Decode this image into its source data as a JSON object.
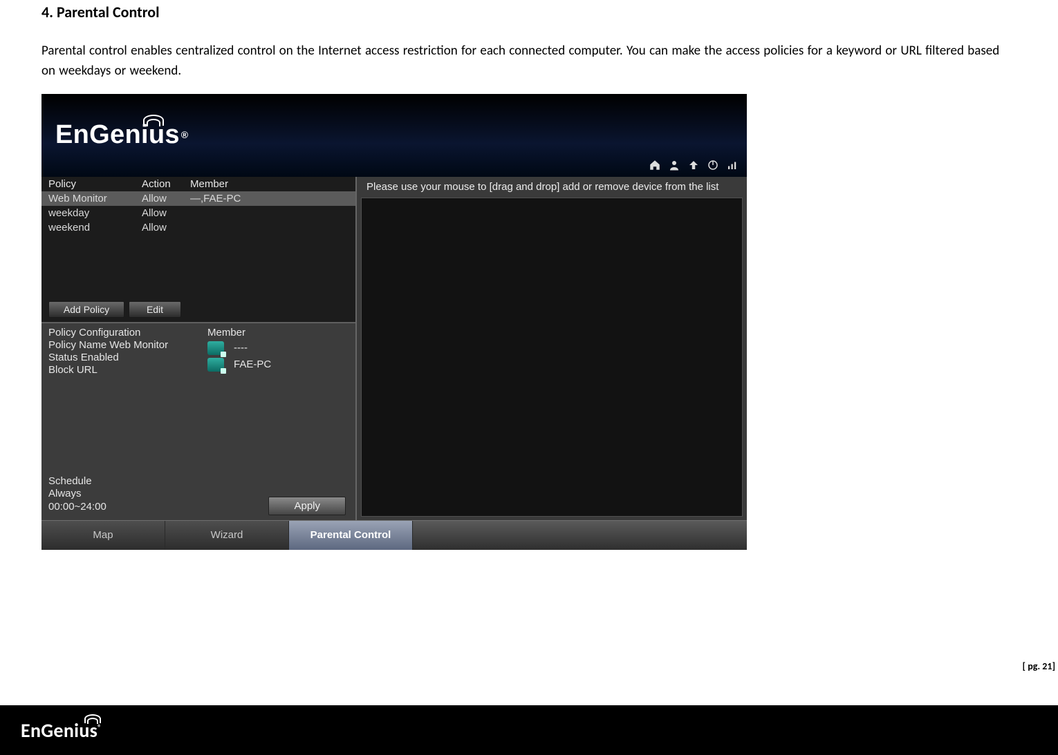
{
  "doc": {
    "heading": "4.  Parental Control",
    "paragraph": "Parental control enables centralized control on the Internet access restriction for each connected computer. You can make the access policies for a keyword or URL filtered based on weekdays or weekend.",
    "page_number": "[ pg. 21]"
  },
  "brand": {
    "name": "EnGenius",
    "registered": "®"
  },
  "toolbar_icons": {
    "home": "home-icon",
    "user": "user-icon",
    "wifi": "network-icon",
    "power": "power-icon",
    "graph": "status-icon"
  },
  "policy_table": {
    "headers": {
      "c1": "Policy",
      "c2": "Action",
      "c3": "Member"
    },
    "rows": [
      {
        "c1": "Web Monitor",
        "c2": "Allow",
        "c3": "—,FAE-PC",
        "selected": true
      },
      {
        "c1": "weekday",
        "c2": "Allow",
        "c3": ""
      },
      {
        "c1": "weekend",
        "c2": "Allow",
        "c3": ""
      }
    ],
    "add_btn": "Add Policy",
    "edit_btn": "Edit"
  },
  "policy_config": {
    "title": "Policy Configuration",
    "name_line": "Policy Name Web Monitor",
    "status_line": "Status Enabled",
    "block_line": "Block URL",
    "member_header": "Member",
    "members": [
      {
        "label": "----"
      },
      {
        "label": "FAE-PC"
      }
    ],
    "schedule_title": "Schedule",
    "schedule_mode": "Always",
    "schedule_time": "00:00~24:00",
    "apply_btn": "Apply"
  },
  "right": {
    "instruction": "Please use your mouse to [drag and drop] add or remove device from the list"
  },
  "footer_tabs": {
    "map": "Map",
    "wizard": "Wizard",
    "parental": "Parental Control"
  }
}
